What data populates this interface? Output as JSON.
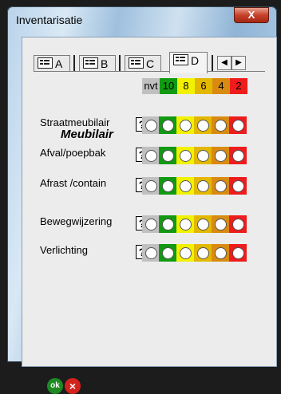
{
  "window": {
    "title": "Inventarisatie",
    "close_label": "X"
  },
  "tabs": [
    {
      "label": "A",
      "active": false
    },
    {
      "label": "B",
      "active": false
    },
    {
      "label": "C",
      "active": false
    },
    {
      "label": "D",
      "active": true
    }
  ],
  "spin_buttons": {
    "left": "◀",
    "right": "▶"
  },
  "score_headers": [
    {
      "label": "nvt",
      "color": "#c0c0c0"
    },
    {
      "label": "10",
      "color": "#119a11"
    },
    {
      "label": "8",
      "color": "#f2f200"
    },
    {
      "label": "6",
      "color": "#e3b800"
    },
    {
      "label": "4",
      "color": "#d98a10"
    },
    {
      "label": "2",
      "color": "#ee1c1c"
    }
  ],
  "section_title": "Meubilair",
  "rows": [
    {
      "label": "Straatmeubilair",
      "qmark": "?"
    },
    {
      "label": "Afval/poepbak",
      "qmark": "?"
    },
    {
      "label": "Afrast /contain",
      "qmark": "?"
    },
    {
      "label": "Bewegwijzering",
      "qmark": "?"
    },
    {
      "label": "Verlichting",
      "qmark": "?"
    }
  ],
  "footer": {
    "ok_label": "ok",
    "cancel_label": "×"
  }
}
